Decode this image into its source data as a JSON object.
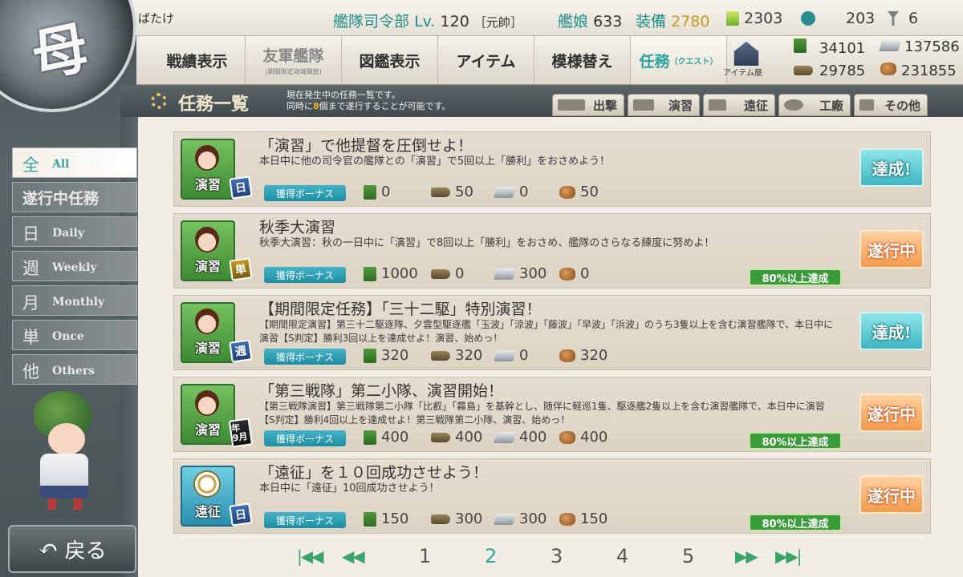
{
  "header": {
    "player_name": "ばたけ",
    "hq_label": "艦隊司令部",
    "level_label": "Lv.",
    "level": "120",
    "rank": "［元帥］",
    "shipgirls_label": "艦娘",
    "shipgirls": "633",
    "equip_label": "装備",
    "equip": "2780",
    "buckets": "2303",
    "dev_mats": "203",
    "screws": "6",
    "logo_char": "母"
  },
  "nav": {
    "items": [
      {
        "label": "戦績表示",
        "sub": ""
      },
      {
        "label": "友軍艦隊",
        "sub": "(期間限定海域開放)"
      },
      {
        "label": "図鑑表示",
        "sub": ""
      },
      {
        "label": "アイテム",
        "sub": ""
      },
      {
        "label": "模様替え",
        "sub": ""
      },
      {
        "label": "任務",
        "sub": "（クエスト）"
      }
    ],
    "shop_label": "アイテム屋"
  },
  "resources": {
    "fuel": "34101",
    "steel": "137586",
    "ammo": "29785",
    "bauxite": "231855"
  },
  "titlebar": {
    "title": "任務一覧",
    "desc_line1": "現在発生中の任務一覧です。",
    "desc_line2_pre": "同時に",
    "desc_line2_num": "8",
    "desc_line2_post": "個まで遂行することが可能です。",
    "tabs": [
      "出撃",
      "演習",
      "遠征",
      "工廠",
      "その他"
    ]
  },
  "filters": [
    {
      "big": "全",
      "small": "All"
    },
    {
      "big": "遂行中任務",
      "small": ""
    },
    {
      "big": "日",
      "small": "Daily"
    },
    {
      "big": "週",
      "small": "Weekly"
    },
    {
      "big": "月",
      "small": "Monthly"
    },
    {
      "big": "単",
      "small": "Once"
    },
    {
      "big": "他",
      "small": "Others"
    }
  ],
  "bonus_label": "獲得ボーナス",
  "quests": [
    {
      "category": "演習",
      "badge": "日",
      "title": "「演習」で他提督を圧倒せよ！",
      "desc": "本日中に他の司令官の艦隊との「演習」で5回以上「勝利」をおさめよう！",
      "fuel": "0",
      "ammo": "50",
      "steel": "0",
      "bauxite": "50",
      "progress": "",
      "status": "達成!"
    },
    {
      "category": "演習",
      "badge": "単",
      "title": "秋季大演習",
      "desc": "秋季大演習：秋の一日中に「演習」で8回以上「勝利」をおさめ、艦隊のさらなる練度に努めよ！",
      "fuel": "1000",
      "ammo": "0",
      "steel": "300",
      "bauxite": "0",
      "progress": "80%以上達成",
      "status": "遂行中"
    },
    {
      "category": "演習",
      "badge": "週",
      "title": "【期間限定任務】「三十二駆」特別演習！",
      "desc": "【期間限定演習】第三十二駆逐隊、夕雲型駆逐艦「玉波」「涼波」「藤波」「早波」「浜波」のうち3隻以上を含む演習艦隊で、本日中に演習【S判定】勝利3回以上を達成せよ！演習、始めっ！",
      "fuel": "320",
      "ammo": "320",
      "steel": "0",
      "bauxite": "320",
      "progress": "",
      "status": "達成!"
    },
    {
      "category": "演習",
      "badge": "年 9月",
      "title": "「第三戦隊」第二小隊、演習開始！",
      "desc": "【第三戦隊演習】第三戦隊第二小隊「比叡」「霧島」を基幹とし、随伴に軽巡1隻、駆逐艦2隻以上を含む演習艦隊で、本日中に演習【S判定】勝利4回以上を達成せよ！第三戦隊第二小隊、演習、始めっ！",
      "fuel": "400",
      "ammo": "400",
      "steel": "400",
      "bauxite": "400",
      "progress": "80%以上達成",
      "status": "遂行中"
    },
    {
      "category": "遠征",
      "badge": "日",
      "title": "「遠征」を１０回成功させよう！",
      "desc": "本日中に「遠征」10回成功させよう！",
      "fuel": "150",
      "ammo": "300",
      "steel": "300",
      "bauxite": "150",
      "progress": "80%以上達成",
      "status": "遂行中"
    }
  ],
  "pagination": {
    "pages": [
      "1",
      "2",
      "3",
      "4",
      "5"
    ],
    "current": "2",
    "first": "|◀◀",
    "prev": "◀◀",
    "next": "▶▶",
    "last": "▶▶|"
  },
  "back_label": "戻る"
}
